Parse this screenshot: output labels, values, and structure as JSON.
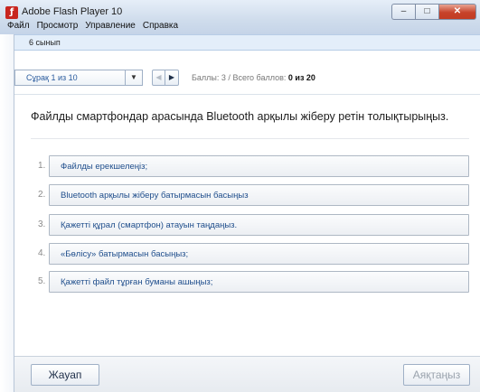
{
  "window": {
    "title": "Adobe Flash Player 10",
    "icon": "flash-icon",
    "controls": {
      "minimize": "–",
      "maximize": "□",
      "close": "✕"
    }
  },
  "menu": [
    "Файл",
    "Просмотр",
    "Управление",
    "Справка"
  ],
  "course": {
    "label": "6 сынып"
  },
  "toolbar": {
    "question_select": "Сұрақ 1 из 10",
    "score_label": "Баллы: 3",
    "separator": "/",
    "total_label": "Всего баллов:",
    "total_value": "0 из 20"
  },
  "question": {
    "text": "Файлды смартфондар арасында Bluetooth арқылы жіберу ретін толықтырыңыз."
  },
  "answers": [
    {
      "num": "1.",
      "text": "Файлды ерекшелеңіз;"
    },
    {
      "num": "2.",
      "text": "Bluetooth арқылы жіберу батырмасын басыңыз"
    },
    {
      "num": "3.",
      "text": "Қажетті құрал (смартфон) атауын таңдаңыз."
    },
    {
      "num": "4.",
      "text": "«Бөлісу» батырмасын басыңыз;"
    },
    {
      "num": "5.",
      "text": "Қажетті файл тұрған буманы ашыңыз;"
    }
  ],
  "buttons": {
    "answer": "Жауап",
    "finish": "Аяқтаңыз"
  },
  "colors": {
    "accent": "#1f4e8c",
    "brand": "#c8261f",
    "course_bar": "#e3eefa"
  }
}
